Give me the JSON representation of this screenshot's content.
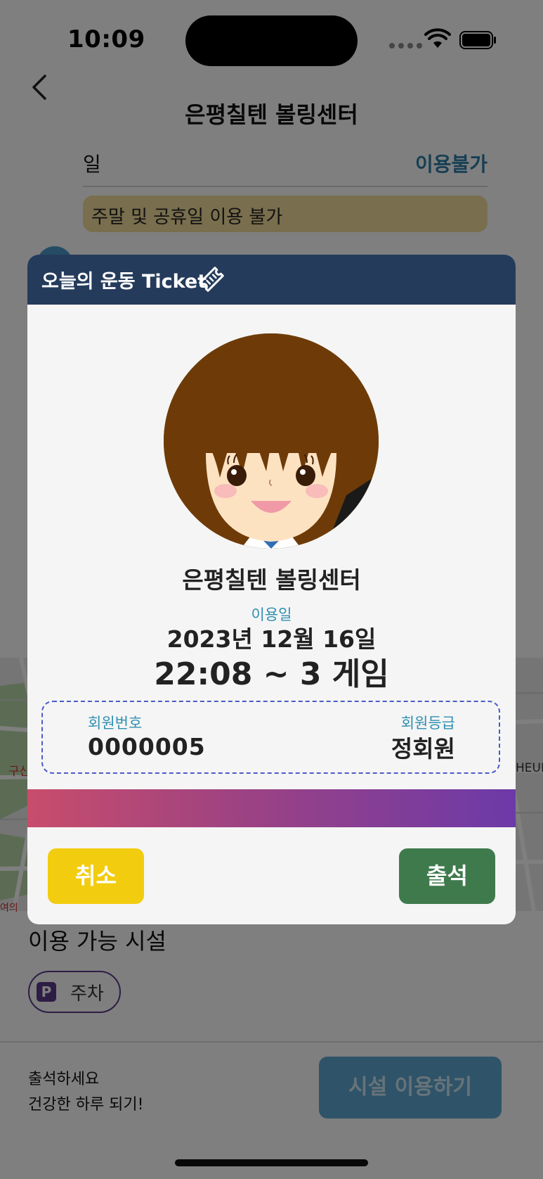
{
  "status_bar": {
    "time": "10:09"
  },
  "header": {
    "title": "은평칠텐 볼링센터"
  },
  "schedule": {
    "day": "일",
    "status": "이용불가",
    "notice": "주말 및 공휴일 이용 불가"
  },
  "map": {
    "label_left": "구산",
    "label_right": "HEUI",
    "label_bottom": "여의"
  },
  "facilities": {
    "title": "이용 가능 시설",
    "items": [
      {
        "icon": "P",
        "label": "주차"
      }
    ]
  },
  "bottom_bar": {
    "line1": "출석하세요",
    "line2": "건강한 하루 되기!",
    "use_button": "시설 이용하기"
  },
  "modal": {
    "header_title": "오늘의 운동 Ticket",
    "center_name": "은평칠텐 볼링센터",
    "date_label": "이용일",
    "date_value": "2023년 12월 16일",
    "time_games": "22:08 ~  3 게임",
    "member_number_label": "회원번호",
    "member_number": "0000005",
    "member_grade_label": "회원등급",
    "member_grade": "정회원",
    "cancel_label": "취소",
    "attend_label": "출석"
  },
  "colors": {
    "modal_header": "#253b5b",
    "accent_label": "#2f8fb0",
    "cancel": "#f2cc0f",
    "attend": "#3f7a4c",
    "gradient_start": "#c84d6b",
    "gradient_end": "#6c3aa8"
  }
}
